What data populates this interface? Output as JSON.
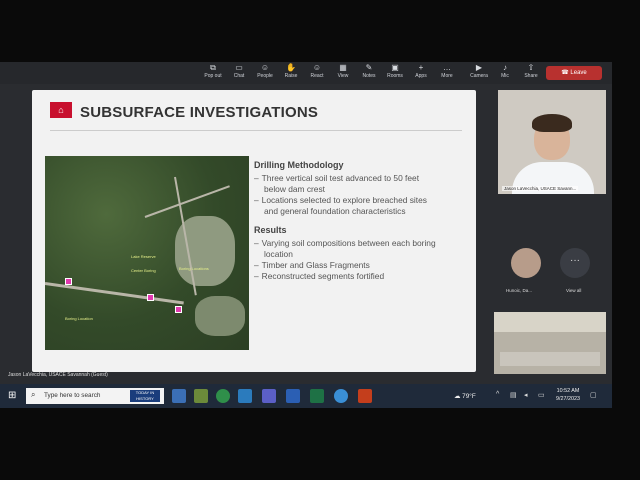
{
  "toolbar": {
    "items": [
      {
        "label": "Pop out",
        "icon": "pop-out-icon"
      },
      {
        "label": "Chat",
        "icon": "chat-icon"
      },
      {
        "label": "People",
        "icon": "people-icon"
      },
      {
        "label": "Raise",
        "icon": "raise-hand-icon"
      },
      {
        "label": "React",
        "icon": "react-icon"
      },
      {
        "label": "View",
        "icon": "view-icon"
      },
      {
        "label": "Notes",
        "icon": "notes-icon"
      },
      {
        "label": "Rooms",
        "icon": "rooms-icon"
      },
      {
        "label": "Apps",
        "icon": "apps-icon"
      },
      {
        "label": "More",
        "icon": "more-icon"
      },
      {
        "label": "Camera",
        "icon": "camera-icon"
      },
      {
        "label": "Mic",
        "icon": "mic-icon"
      },
      {
        "label": "Share",
        "icon": "share-icon"
      }
    ],
    "leave_label": "Leave"
  },
  "slide": {
    "title": "SUBSURFACE INVESTIGATIONS",
    "section1_heading": "Drilling Methodology",
    "section1_items": [
      "Three vertical soil test advanced to 50 feet",
      "below dam crest",
      "Locations selected to explore breached sites",
      "and general foundation characteristics"
    ],
    "section2_heading": "Results",
    "section2_items": [
      "Varying soil compositions between each boring",
      "location",
      "Timber and Glass Fragments",
      "Reconstructed segments fortified"
    ],
    "map_labels": [
      "Lake Reserve",
      "Center Boring",
      "Boring Locations",
      "Boring Location"
    ]
  },
  "presenter": "Jason LaVecchia, USACE Savannah (Guest)",
  "participants": {
    "video_name": "Jason LaVecchia, USACE Savann...",
    "avatar_name": "Hunoic, Da...",
    "more_label": "View all"
  },
  "taskbar": {
    "search_placeholder": "Type here to search",
    "search_badge": "TODAY IN HISTORY",
    "weather": "79°F",
    "time": "10:52 AM",
    "date": "9/27/2023"
  },
  "colors": {
    "accent": "#c8102e",
    "leave": "#b8312f",
    "taskbar": "#1f2a3a"
  }
}
